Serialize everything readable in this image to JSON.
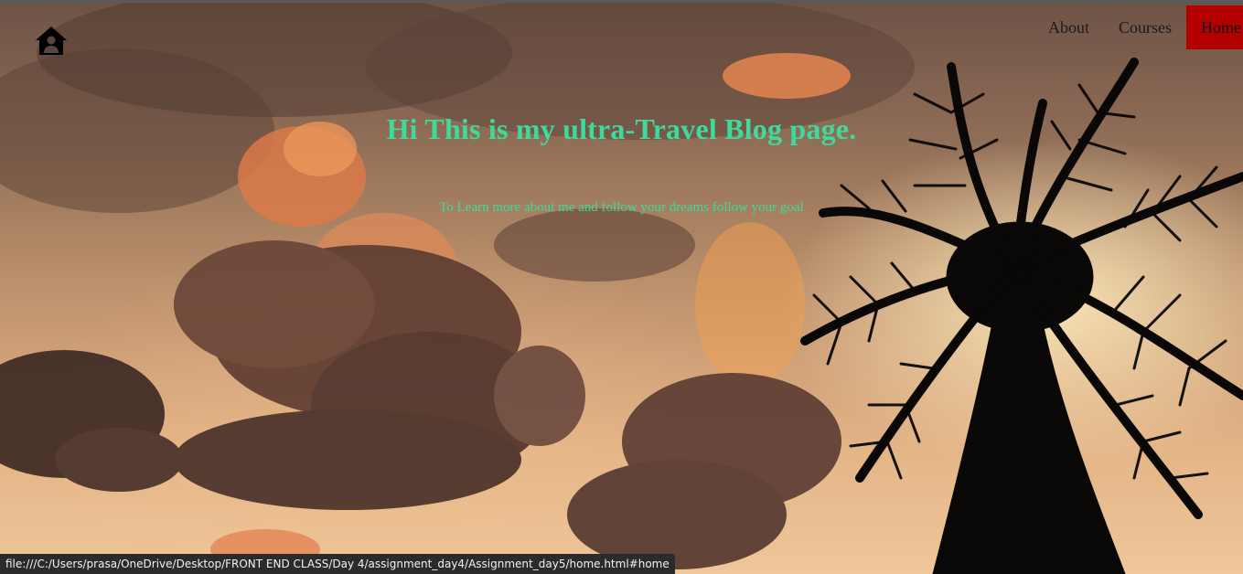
{
  "nav": {
    "items": [
      {
        "label": "About"
      },
      {
        "label": "Courses"
      },
      {
        "label": "Home"
      }
    ],
    "active_color": "#b30000"
  },
  "logo": {
    "icon": "home-user-icon"
  },
  "hero": {
    "headline": "Hi This is my ultra-Travel Blog page.",
    "subtext": "To Learn more about me and follow your dreams follow your goal",
    "text_color": "#3fd99b",
    "background": "sunset sky with clouds and palm tree silhouette"
  },
  "status_bar": {
    "url": "file:///C:/Users/prasa/OneDrive/Desktop/FRONT END CLASS/Day 4/assignment_day4/Assignment_day5/home.html#home"
  }
}
